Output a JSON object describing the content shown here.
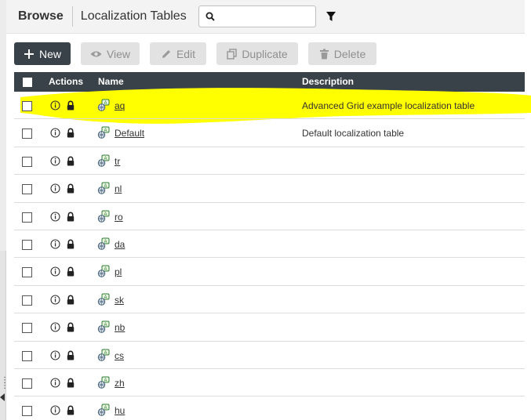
{
  "header": {
    "browse_label": "Browse",
    "title": "Localization Tables",
    "search": {
      "value": "",
      "placeholder": ""
    },
    "search_icon": "search-icon",
    "filter_icon": "filter-icon"
  },
  "toolbar": {
    "new_label": "New",
    "view_label": "View",
    "edit_label": "Edit",
    "duplicate_label": "Duplicate",
    "delete_label": "Delete"
  },
  "grid": {
    "columns": {
      "actions": "Actions",
      "name": "Name",
      "description": "Description"
    },
    "rows": [
      {
        "name": "aq",
        "description": "Advanced Grid example localization table",
        "highlighted": true
      },
      {
        "name": "Default",
        "description": "Default localization table"
      },
      {
        "name": "tr",
        "description": ""
      },
      {
        "name": "nl",
        "description": ""
      },
      {
        "name": "ro",
        "description": ""
      },
      {
        "name": "da",
        "description": ""
      },
      {
        "name": "pl",
        "description": ""
      },
      {
        "name": "sk",
        "description": ""
      },
      {
        "name": "nb",
        "description": ""
      },
      {
        "name": "cs",
        "description": ""
      },
      {
        "name": "zh",
        "description": ""
      },
      {
        "name": "hu",
        "description": ""
      }
    ]
  },
  "colors": {
    "toolbar_dark": "#3a4249",
    "highlight": "#ffff00",
    "disabled_button": "#e2e2e2"
  }
}
